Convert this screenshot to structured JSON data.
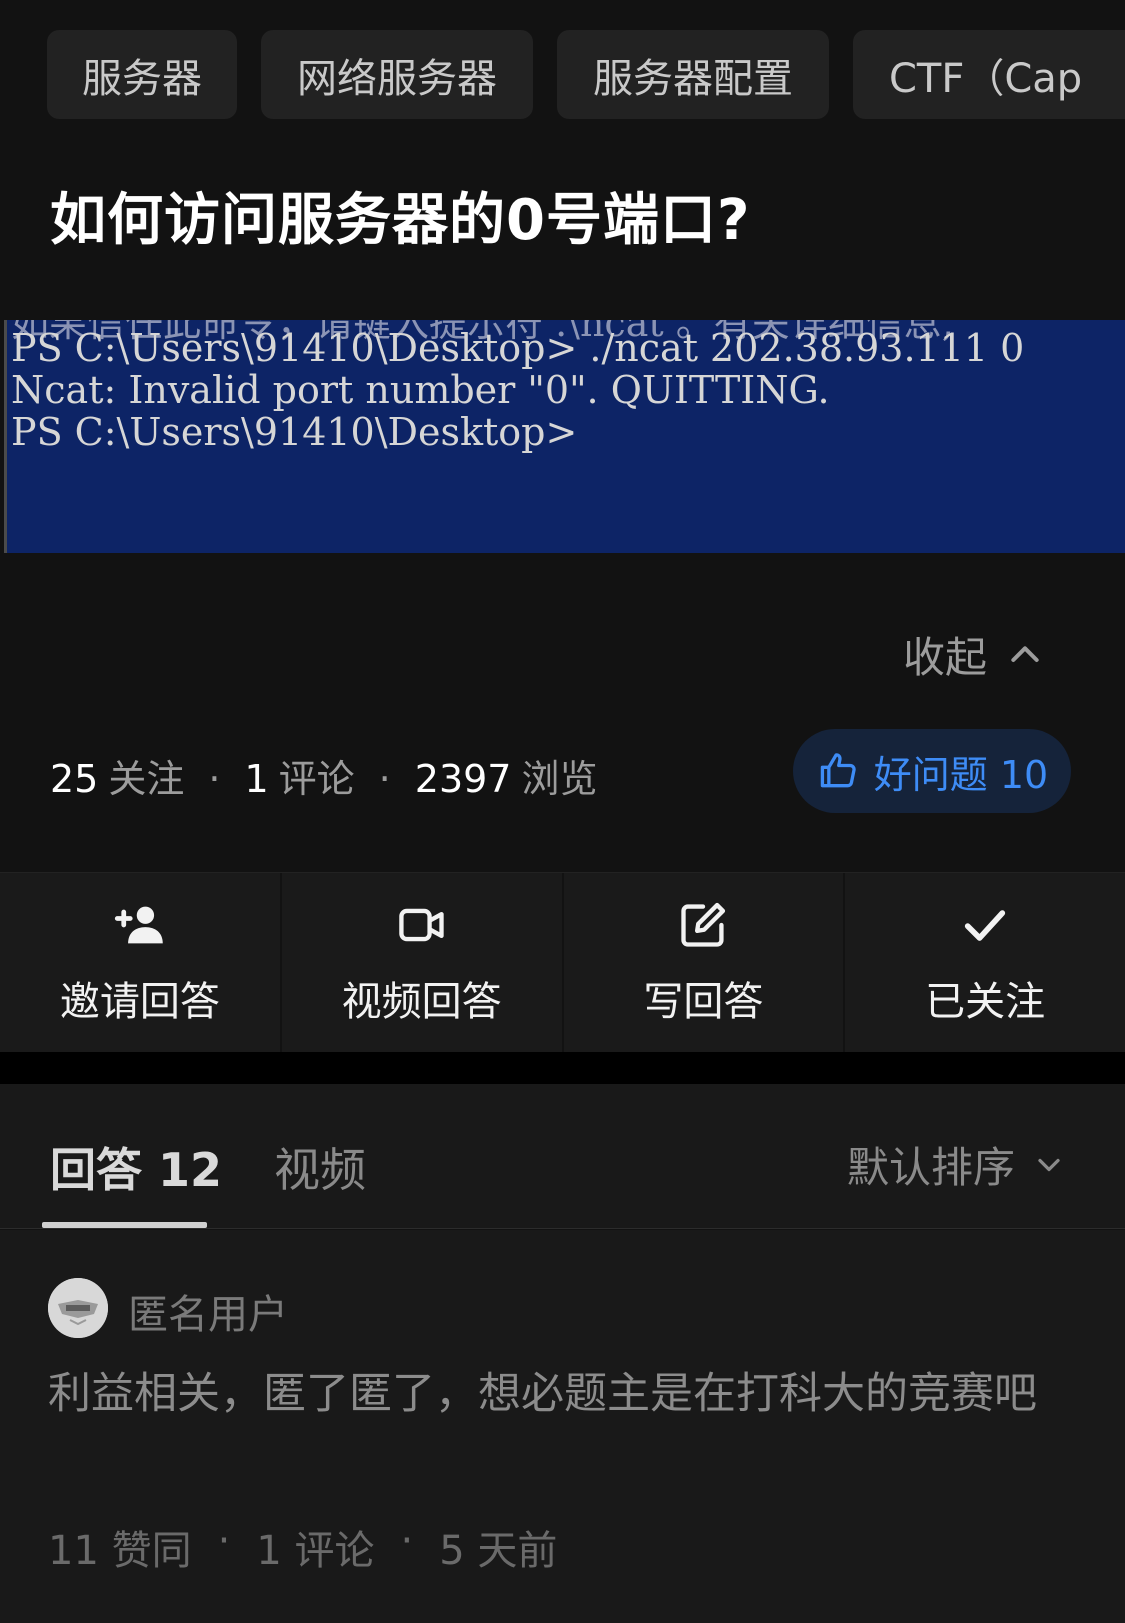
{
  "tags": [
    "服务器",
    "网络服务器",
    "服务器配置",
    "CTF（Cap"
  ],
  "question": {
    "title": "如何访问服务器的0号端口?"
  },
  "terminal": {
    "ghost_line": "如果信任此命令，请键入提示符 .\\ncat 。有关详细信息,",
    "lines": [
      "PS C:\\Users\\91410\\Desktop> ./ncat 202.38.93.111 0",
      "Ncat: Invalid port number \"0\". QUITTING.",
      "PS C:\\Users\\91410\\Desktop>"
    ]
  },
  "collapse_label": "收起",
  "stats": {
    "follows_num": "25",
    "follows_label": "关注",
    "comments_num": "1",
    "comments_label": "评论",
    "views_num": "2397",
    "views_label": "浏览",
    "separator": "·"
  },
  "good_question": {
    "label": "好问题 10",
    "icon": "thumbs-up-icon",
    "color": "#3e8cf6"
  },
  "actions": [
    {
      "label": "邀请回答",
      "icon": "add-user-icon"
    },
    {
      "label": "视频回答",
      "icon": "video-camera-icon"
    },
    {
      "label": "写回答",
      "icon": "edit-icon"
    },
    {
      "label": "已关注",
      "icon": "check-icon"
    }
  ],
  "tabs": {
    "answers": "回答 12",
    "video": "视频",
    "sort": "默认排序"
  },
  "answer": {
    "author": "匿名用户",
    "text": "利益相关，匿了匿了，想必题主是在打科大的竞赛吧",
    "likes": "11 赞同",
    "comments": "1 评论",
    "time": "5 天前",
    "separator": "·"
  }
}
